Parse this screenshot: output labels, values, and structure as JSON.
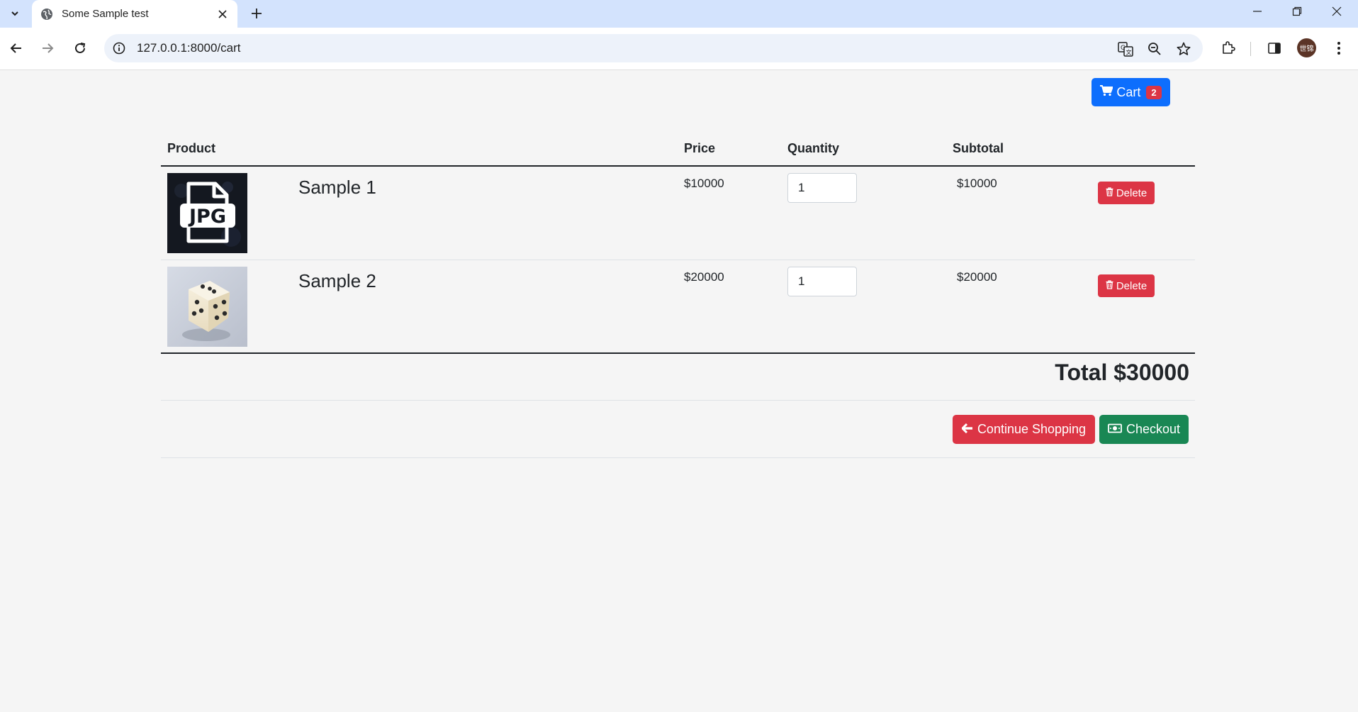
{
  "browser": {
    "tab_title": "Some Sample test",
    "url": "127.0.0.1:8000/cart",
    "avatar_text": "世锦",
    "icons": [
      "tab-search-icon",
      "globe-icon",
      "close-icon",
      "plus-icon",
      "minimize-icon",
      "restore-icon",
      "window-close-icon",
      "back-icon",
      "forward-icon",
      "reload-icon",
      "info-icon",
      "translate-icon",
      "zoom-icon",
      "star-icon",
      "extensions-icon",
      "side-panel-icon",
      "menu-icon"
    ]
  },
  "header": {
    "cart_label": "Cart",
    "cart_count": "2",
    "cart_icon": "shopping-cart-icon"
  },
  "table": {
    "headers": {
      "product": "Product",
      "price": "Price",
      "quantity": "Quantity",
      "subtotal": "Subtotal"
    },
    "rows": [
      {
        "name": "Sample 1",
        "price": "$10000",
        "quantity": "1",
        "subtotal": "$10000",
        "delete_label": "Delete",
        "thumb": "jpg-file-image"
      },
      {
        "name": "Sample 2",
        "price": "$20000",
        "quantity": "1",
        "subtotal": "$20000",
        "delete_label": "Delete",
        "thumb": "dice-image"
      }
    ]
  },
  "summary": {
    "total": "Total $30000",
    "continue_label": "Continue Shopping",
    "checkout_label": "Checkout"
  },
  "colors": {
    "primary": "#0d6efd",
    "danger": "#dc3545",
    "success": "#198754"
  }
}
